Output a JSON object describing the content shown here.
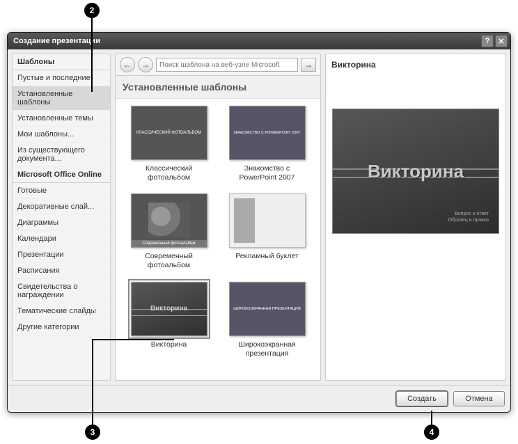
{
  "callouts": {
    "c2": "2",
    "c3": "3",
    "c4": "4"
  },
  "dialog": {
    "title": "Создание презентации",
    "help_label": "?",
    "close_label": "✕"
  },
  "sidebar": {
    "head1": "Шаблоны",
    "items_a": [
      "Пустые и последние",
      "Установленные шаблоны",
      "Установленные темы",
      "Мои шаблоны...",
      "Из существующего документа..."
    ],
    "selected_a": 1,
    "head2": "Microsoft Office Online",
    "items_b": [
      "Готовые",
      "Декоративные слай...",
      "Диаграммы",
      "Календари",
      "Презентации",
      "Расписания",
      "Свидетельства о награждении",
      "Тематические слайды",
      "Другие категории"
    ]
  },
  "nav": {
    "back": "←",
    "forward": "→",
    "search_placeholder": "Поиск шаблона на веб-узле Microsoft",
    "go": "→"
  },
  "section_title": "Установленные шаблоны",
  "templates": [
    {
      "label": "Классический фотоальбом",
      "inner": "КЛАССИЧЕСКИЙ ФОТОАЛЬБОМ",
      "style": "dark"
    },
    {
      "label": "Знакомство с PowerPoint 2007",
      "inner": "ЗНАКОМСТВО С POWERPOINT 2007",
      "style": "darkblue"
    },
    {
      "label": "Современный фотоальбом",
      "inner": "Современный фотоальбом",
      "style": "photo"
    },
    {
      "label": "Рекламный буклет",
      "inner": "",
      "style": "light"
    },
    {
      "label": "Викторина",
      "inner": "Викторина",
      "style": "banded",
      "selected": true
    },
    {
      "label": "Широкоэкранная презентация",
      "inner": "ШИРОКОЭКРАННАЯ ПРЕЗЕНТАЦИЯ",
      "style": "darkblue"
    }
  ],
  "preview": {
    "title": "Викторина",
    "main": "Викторина",
    "sub1": "Вопрос и ответ",
    "sub2": "Образец и правка"
  },
  "buttons": {
    "create": "Создать",
    "cancel": "Отмена"
  }
}
